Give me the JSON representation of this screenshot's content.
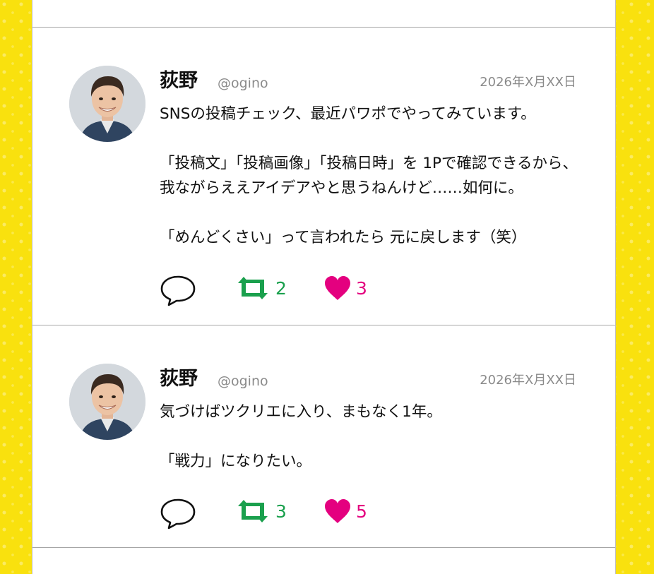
{
  "colors": {
    "background": "#f9e10e",
    "retweet": "#1aa04d",
    "like": "#e4007f"
  },
  "posts": [
    {
      "name": "荻野",
      "handle": "@ogino",
      "date": "2026年X月XX日",
      "lines": [
        "SNSの投稿チェック、最近パワポでやってみています。",
        "",
        "「投稿文」「投稿画像」「投稿日時」を 1Pで確認できるから、",
        "我ながらええアイデアやと思うねんけど……如何に。",
        "",
        "「めんどくさい」って言われたら 元に戻します（笑）"
      ],
      "retweets": "2",
      "likes": "3",
      "icons": [
        "speech-bubble-icon",
        "retweet-icon",
        "heart-icon"
      ]
    },
    {
      "name": "荻野",
      "handle": "@ogino",
      "date": "2026年X月XX日",
      "lines": [
        "気づけばツクリエに入り、まもなく1年。",
        "",
        "「戦力」になりたい。"
      ],
      "retweets": "3",
      "likes": "5",
      "icons": [
        "speech-bubble-icon",
        "retweet-icon",
        "heart-icon"
      ]
    }
  ]
}
